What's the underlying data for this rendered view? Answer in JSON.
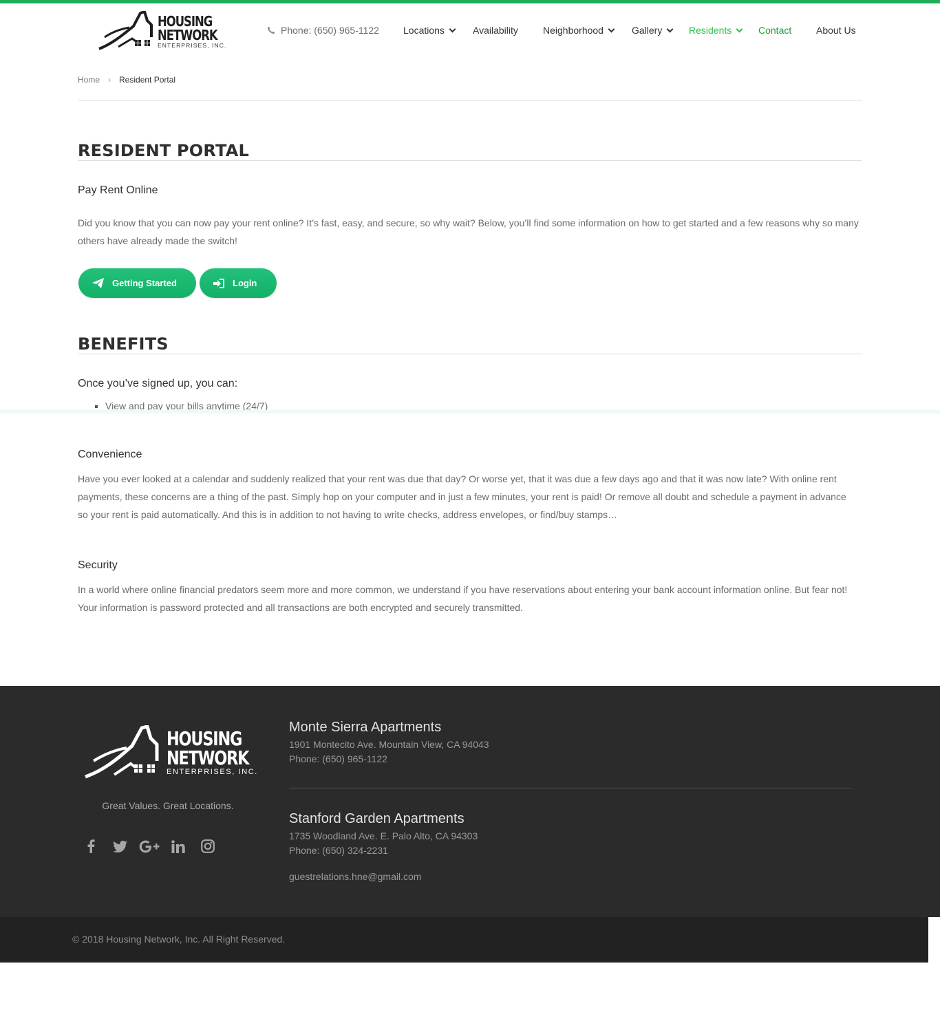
{
  "header": {
    "logo": {
      "line1": "HOUSING",
      "line2": "NETWORK",
      "line3": "ENTERPRISES, INC."
    },
    "phone": "Phone: (650) 965-1122",
    "nav": [
      {
        "label": "Locations"
      },
      {
        "label": "Availability"
      },
      {
        "label": "Neighborhood"
      },
      {
        "label": "Gallery"
      },
      {
        "label": "Residents"
      },
      {
        "label": "Contact"
      },
      {
        "label": "About Us"
      }
    ],
    "colors": {
      "accent": "#1fae5b",
      "active": "#2fc14a"
    }
  },
  "breadcrumb": {
    "home": "Home",
    "separator": "›",
    "current": "Resident Portal"
  },
  "portal": {
    "title": "RESIDENT PORTAL",
    "subtitle": "Pay Rent Online",
    "intro": "Did you know that you can now pay your rent online? It’s fast, easy, and secure, so why wait? Below, you’ll find some information on how to get started and a few reasons why so many others have already made the switch!",
    "buttons": {
      "getting_started": "Getting Started",
      "login": "Login"
    }
  },
  "benefits": {
    "title": "BENEFITS",
    "intro": "Once you’ve signed up, you can:",
    "items": [
      "View and pay your bills anytime (24/7)"
    ],
    "convenience": {
      "title": "Convenience",
      "text": "Have you ever looked at a calendar and suddenly realized that your rent was due that day? Or worse yet, that it was due a few days ago and that it was now late? With online rent payments, these concerns are a thing of the past. Simply hop on your computer and in just a few minutes, your rent is paid! Or remove all doubt and schedule a payment in advance so your rent is paid automatically. And this is in addition to not having to write checks, address envelopes, or find/buy stamps…"
    },
    "security": {
      "title": "Security",
      "text": "In a world where online financial predators seem more and more common, we understand if you have reservations about entering your bank account information online. But fear not! Your information is password protected and all transactions are both encrypted and securely transmitted."
    }
  },
  "footer": {
    "logo": {
      "line1": "HOUSING",
      "line2": "NETWORK",
      "line3": "ENTERPRISES, INC."
    },
    "tagline": "Great Values. Great Locations.",
    "social": [
      "facebook-icon",
      "twitter-icon",
      "google-plus-icon",
      "linkedin-icon",
      "instagram-icon"
    ],
    "locations": [
      {
        "name": "Monte Sierra Apartments",
        "address": "1901 Montecito Ave. Mountain View, CA 94043",
        "phone": "Phone: (650) 965-1122"
      },
      {
        "name": "Stanford Garden Apartments",
        "address": "1735 Woodland Ave. E. Palo Alto, CA 94303",
        "phone": "Phone: (650) 324-2231"
      }
    ],
    "email": "guestrelations.hne@gmail.com",
    "copyright": "© 2018 Housing Network, Inc. All Right Reserved."
  }
}
